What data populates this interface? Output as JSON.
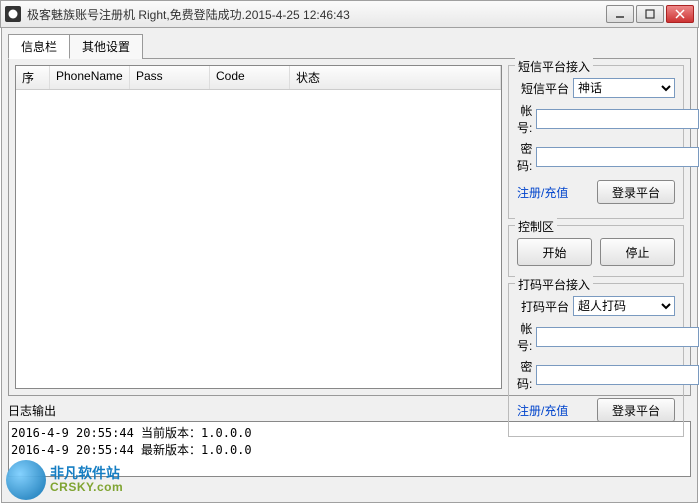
{
  "window": {
    "title": "极客魅族账号注册机      Right,免费登陆成功.2015-4-25 12:46:43"
  },
  "tabs": {
    "info": "信息栏",
    "other": "其他设置"
  },
  "list": {
    "cols": {
      "seq": "序",
      "phone": "PhoneName",
      "pass": "Pass",
      "code": "Code",
      "status": "状态"
    }
  },
  "sms": {
    "legend": "短信平台接入",
    "platform_label": "短信平台",
    "platform_value": "神话",
    "account_label": "帐号:",
    "password_label": "密码:",
    "reg_link": "注册/充值",
    "login_btn": "登录平台"
  },
  "control": {
    "legend": "控制区",
    "start": "开始",
    "stop": "停止"
  },
  "dama": {
    "legend": "打码平台接入",
    "platform_label": "打码平台",
    "platform_value": "超人打码",
    "account_label": "帐号:",
    "password_label": "密码:",
    "reg_link": "注册/充值",
    "login_btn": "登录平台"
  },
  "log": {
    "label": "日志输出",
    "content": "2016-4-9 20:55:44 当前版本：1.0.0.0\n2016-4-9 20:55:44 最新版本：1.0.0.0"
  },
  "watermark": {
    "cn": "非凡软件站",
    "en": "CRSKY.com"
  }
}
